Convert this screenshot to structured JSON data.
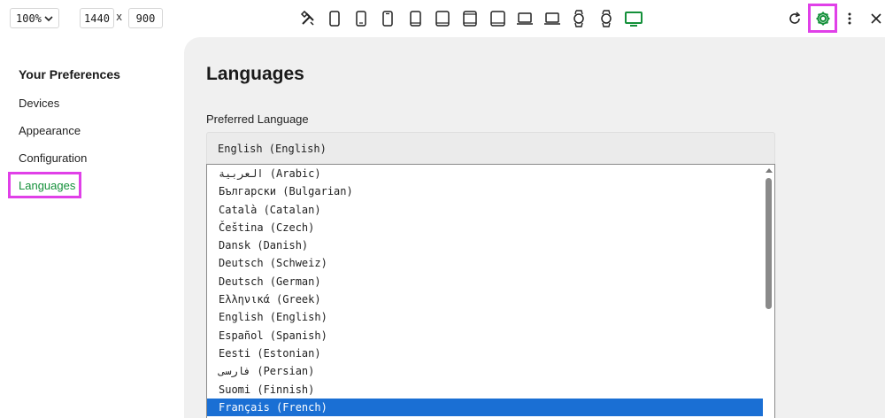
{
  "toolbar": {
    "zoom": "100%",
    "width": "1440",
    "height": "900",
    "times": "x",
    "devices": [
      "tools-icon",
      "phone-icon",
      "phone-icon",
      "phone-icon",
      "tablet-icon",
      "tablet-icon",
      "tablet-icon",
      "laptop-icon",
      "laptop-icon",
      "watch-icon",
      "watch-icon",
      "tv-icon"
    ]
  },
  "colors": {
    "accent": "#14903a",
    "highlight": "#e040e8",
    "selected": "#1a6fd4"
  },
  "sidebar": {
    "title": "Your Preferences",
    "items": [
      {
        "label": "Devices"
      },
      {
        "label": "Appearance"
      },
      {
        "label": "Configuration"
      },
      {
        "label": "Languages"
      }
    ]
  },
  "main": {
    "title": "Languages",
    "field_label": "Preferred Language",
    "selected_value": "English (English)",
    "options": [
      "العربية (Arabic)",
      "Български (Bulgarian)",
      "Català (Catalan)",
      "Čeština (Czech)",
      "Dansk (Danish)",
      "Deutsch (Schweiz)",
      "Deutsch (German)",
      "Ελληνικά (Greek)",
      "English (English)",
      "Español (Spanish)",
      "Eesti (Estonian)",
      "فارسی (Persian)",
      "Suomi (Finnish)",
      "Français (French)"
    ],
    "highlighted_option": "Français (French)"
  }
}
